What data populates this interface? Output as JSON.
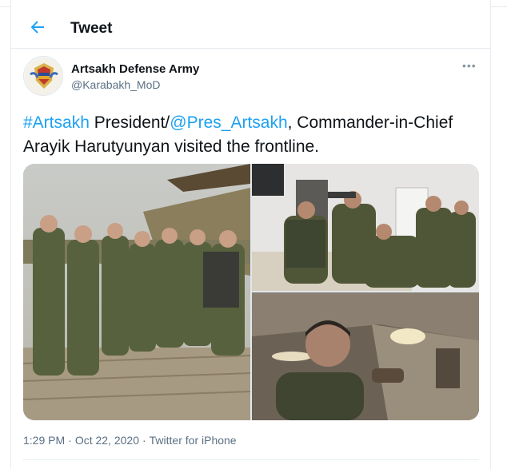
{
  "header": {
    "title": "Tweet"
  },
  "author": {
    "name": "Artsakh Defense Army",
    "handle": "@Karabakh_MoD"
  },
  "tweet": {
    "hashtag": "#Artsakh",
    "text_1": " President/",
    "mention": "@Pres_Artsakh",
    "text_2": ", Commander-in-Chief Arayik Harutyunyan visited the frontline."
  },
  "media": {
    "count": 3
  },
  "meta": {
    "time": "1:29 PM",
    "date": "Oct 22, 2020",
    "separator": "·",
    "source": "Twitter for iPhone"
  },
  "colors": {
    "accent": "#1da1f2",
    "secondary_text": "#5b7083",
    "border": "#e6ecf0"
  }
}
